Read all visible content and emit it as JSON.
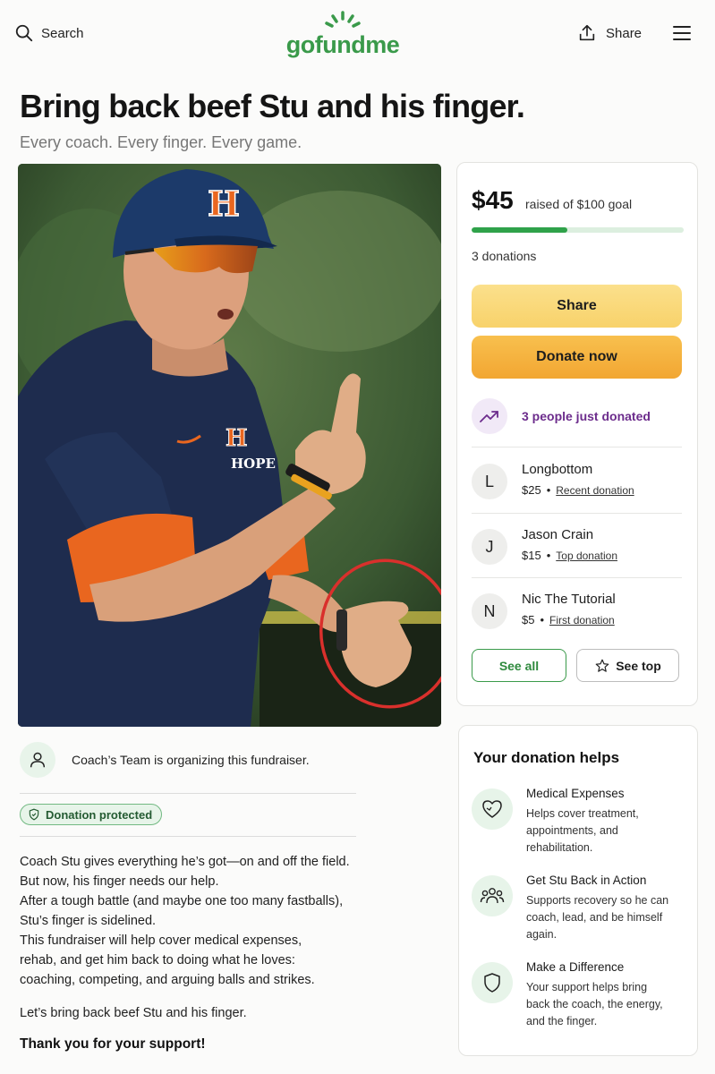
{
  "header": {
    "search_label": "Search",
    "logo_text": "gofundme",
    "share_label": "Share"
  },
  "campaign": {
    "title": "Bring back beef Stu and his finger.",
    "subtitle": "Every coach. Every finger. Every game."
  },
  "donation_card": {
    "amount": "$45",
    "goal_text": "raised of $100 goal",
    "progress_fraction": 0.45,
    "donation_count": "3 donations",
    "share_label": "Share",
    "donate_label": "Donate now",
    "recent_activity": "3 people just donated",
    "donors": [
      {
        "initial": "L",
        "name": "Longbottom",
        "amount": "$25",
        "tag": "Recent donation"
      },
      {
        "initial": "J",
        "name": "Jason Crain",
        "amount": "$15",
        "tag": "Top donation"
      },
      {
        "initial": "N",
        "name": "Nic The Tutorial",
        "amount": "$5",
        "tag": "First donation"
      }
    ],
    "see_all_label": "See all",
    "see_top_label": "See top"
  },
  "organizer": {
    "text": "Coach’s Team is organizing this fundraiser."
  },
  "badge": {
    "label": "Donation protected"
  },
  "story": {
    "lines": [
      "Coach Stu gives everything he’s got—on and off the field.",
      "But now, his finger needs our help.",
      "After a tough battle (and maybe one too many fastballs),",
      "Stu’s finger is sidelined.",
      "This fundraiser will help cover medical expenses,",
      "rehab, and get him back to doing what he loves:",
      "coaching, competing, and arguing balls and strikes."
    ],
    "closing": "Let’s bring back beef Stu and his finger.",
    "thanks": "Thank you for your support!"
  },
  "help": {
    "title": "Your donation helps",
    "items": [
      {
        "icon": "heart-icon",
        "heading": "Medical Expenses",
        "lines": [
          "Helps cover treatment,",
          "appointments, and",
          "rehabilitation."
        ]
      },
      {
        "icon": "people-icon",
        "heading": "Get Stu Back in Action",
        "lines": [
          "Supports recovery so he can",
          "coach, lead, and be himself",
          "again."
        ]
      },
      {
        "icon": "shield-icon",
        "heading": "Make a Difference",
        "lines": [
          "Your support helps bring",
          "back the coach, the energy,",
          "and the finger."
        ]
      }
    ]
  },
  "photo": {
    "cap_letter": "H",
    "jersey_text": "HOPE"
  },
  "colors": {
    "brand_green": "#3a9a4a",
    "progress_green": "#2fa24a",
    "share_yellow": "#f8d26a",
    "donate_orange": "#f2a632",
    "activity_purple": "#6c2c8c",
    "jersey_navy": "#1e2c4e",
    "jersey_orange": "#e9661f",
    "annotation_red": "#d9302c"
  }
}
